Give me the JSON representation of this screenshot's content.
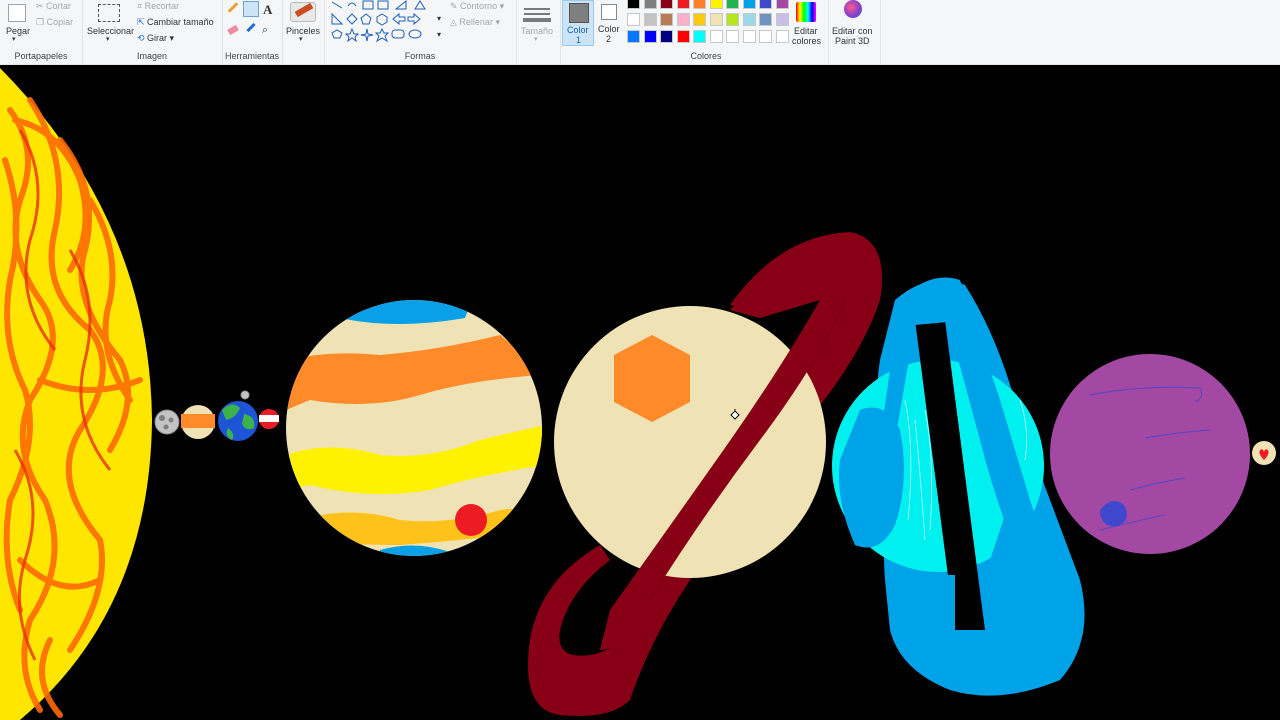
{
  "ribbon": {
    "clipboard": {
      "paste": "Pegar",
      "cut": "Cortar",
      "copy": "Copiar",
      "group": "Portapapeles"
    },
    "image": {
      "select": "Seleccionar",
      "crop": "Recortar",
      "resize": "Cambiar tamaño",
      "rotate": "Girar",
      "group": "Imagen"
    },
    "tools": {
      "group": "Herramientas",
      "text_icon": "A"
    },
    "brushes": {
      "label": "Pinceles"
    },
    "shapes": {
      "outline": "Contorno",
      "fill": "Rellenar",
      "group": "Formas"
    },
    "size": {
      "label": "Tamaño"
    },
    "color1": {
      "line1": "Color",
      "line2": "1"
    },
    "color2": {
      "line1": "Color",
      "line2": "2"
    },
    "colors": {
      "group": "Colores",
      "palette_row1": [
        "#000000",
        "#7f7f7f",
        "#880015",
        "#ed1c24",
        "#ff7f27",
        "#fff200",
        "#22b14c",
        "#00a2e8",
        "#3f48cc",
        "#a349a4"
      ],
      "palette_row2": [
        "#ffffff",
        "#c3c3c3",
        "#b97a57",
        "#ffaec9",
        "#ffc90e",
        "#efe4b0",
        "#b5e61d",
        "#99d9ea",
        "#7092be",
        "#c8bfe7"
      ],
      "palette_row3": [
        "#0078ff",
        "#0000ff",
        "#000080",
        "#ff0000",
        "#00ffff",
        "#ffffff",
        "#ffffff",
        "#ffffff",
        "#ffffff",
        "#ffffff"
      ],
      "edit_line1": "Editar",
      "edit_line2": "colores"
    },
    "paint3d": {
      "line1": "Editar con",
      "line2": "Paint 3D"
    }
  },
  "canvas": {
    "colors": {
      "sun": "#ffe600",
      "sun_flame": "#ff6a00",
      "jupiter_base": "#efe2b4",
      "jupiter_orange": "#ff8a2a",
      "jupiter_yellow": "#fff200",
      "jupiter_gold": "#ffc21a",
      "jupiter_blue": "#0aa0e8",
      "jupiter_spot": "#ed1c24",
      "saturn_base": "#efe2b4",
      "saturn_ring": "#880015",
      "saturn_hex": "#ff8a2a",
      "uranus_base": "#00f0f0",
      "uranus_ring": "#00a2e8",
      "neptune_base": "#a349a4",
      "neptune_spot": "#3f48cc"
    }
  }
}
